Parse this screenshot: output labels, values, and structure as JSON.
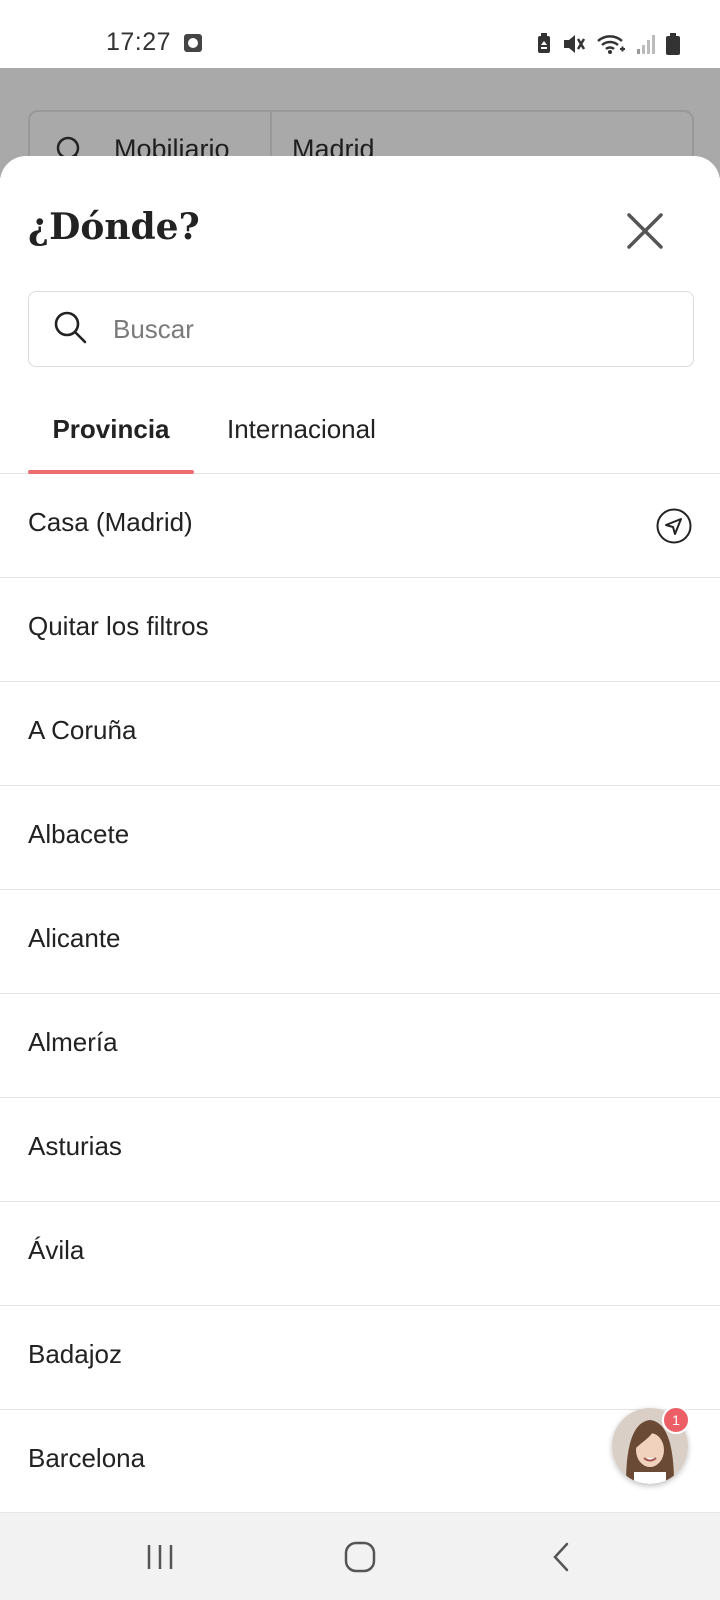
{
  "status_bar": {
    "time": "17:27",
    "icons": [
      "clock-icon",
      "battery-saver-icon",
      "vibrate-icon",
      "wifi-icon",
      "signal-icon",
      "battery-icon"
    ]
  },
  "background_app": {
    "search_query": "Mobiliario",
    "location": "Madrid"
  },
  "sheet": {
    "title": "¿Dónde?",
    "search_placeholder": "Buscar",
    "tabs": [
      {
        "label": "Provincia",
        "active": true
      },
      {
        "label": "Internacional",
        "active": false
      }
    ],
    "items": [
      {
        "label": "Casa (Madrid)",
        "icon": "location-arrow-icon"
      },
      {
        "label": "Quitar los filtros"
      },
      {
        "label": "A Coruña"
      },
      {
        "label": "Albacete"
      },
      {
        "label": "Alicante"
      },
      {
        "label": "Almería"
      },
      {
        "label": "Asturias"
      },
      {
        "label": "Ávila"
      },
      {
        "label": "Badajoz"
      },
      {
        "label": "Barcelona"
      }
    ]
  },
  "chat": {
    "badge_count": "1"
  },
  "colors": {
    "accent": "#ec6c70",
    "badge": "#ec5f66",
    "overlay": "#a9a9a9"
  }
}
